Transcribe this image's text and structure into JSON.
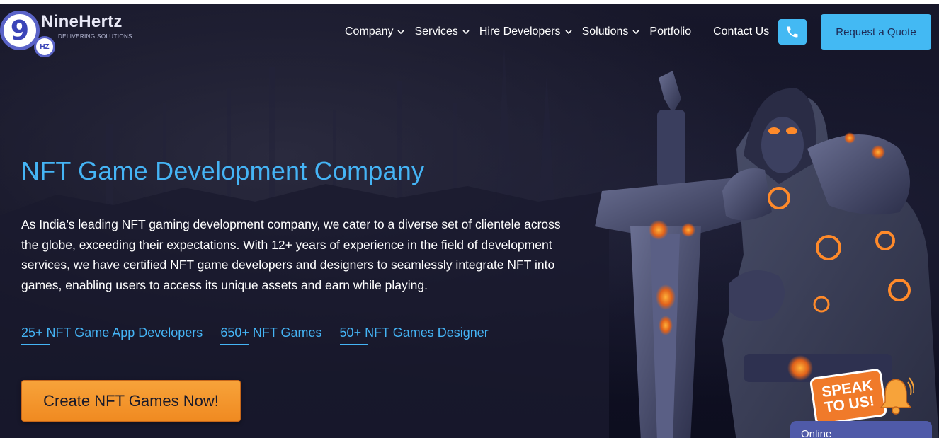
{
  "brand": {
    "digit": "9",
    "badge": "HZ",
    "name": "NineHertz",
    "tagline": "DELIVERING SOLUTIONS"
  },
  "nav": {
    "items": [
      {
        "label": "Company",
        "has_dropdown": true
      },
      {
        "label": "Services",
        "has_dropdown": true
      },
      {
        "label": "Hire Developers",
        "has_dropdown": true
      },
      {
        "label": "Solutions",
        "has_dropdown": true
      },
      {
        "label": "Portfolio",
        "has_dropdown": false
      },
      {
        "label": "Contact Us",
        "has_dropdown": false
      }
    ],
    "phone_icon": "phone-icon",
    "quote_label": "Request a Quote"
  },
  "hero": {
    "title": "NFT Game Development Company",
    "description": "As India’s leading NFT gaming development company, we cater to a diverse set of clientele across the globe, exceeding their expectations. With 12+ years of experience in the field of development services, we have certified NFT game developers and designers to seamlessly integrate NFT into games, enabling users to access its unique assets and earn while playing.",
    "stats": [
      "25+ NFT Game App Developers",
      "650+ NFT Games",
      "50+ NFT Games Designer"
    ],
    "cta_label": "Create NFT Games Now!"
  },
  "speak_badge": {
    "line1": "SPEAK",
    "line2": "TO US!"
  },
  "chat": {
    "status": "Online"
  },
  "colors": {
    "accent_blue": "#45b4f5",
    "button_blue": "#43b9f3",
    "cta_orange": "#f08a21",
    "background": "#101022"
  }
}
